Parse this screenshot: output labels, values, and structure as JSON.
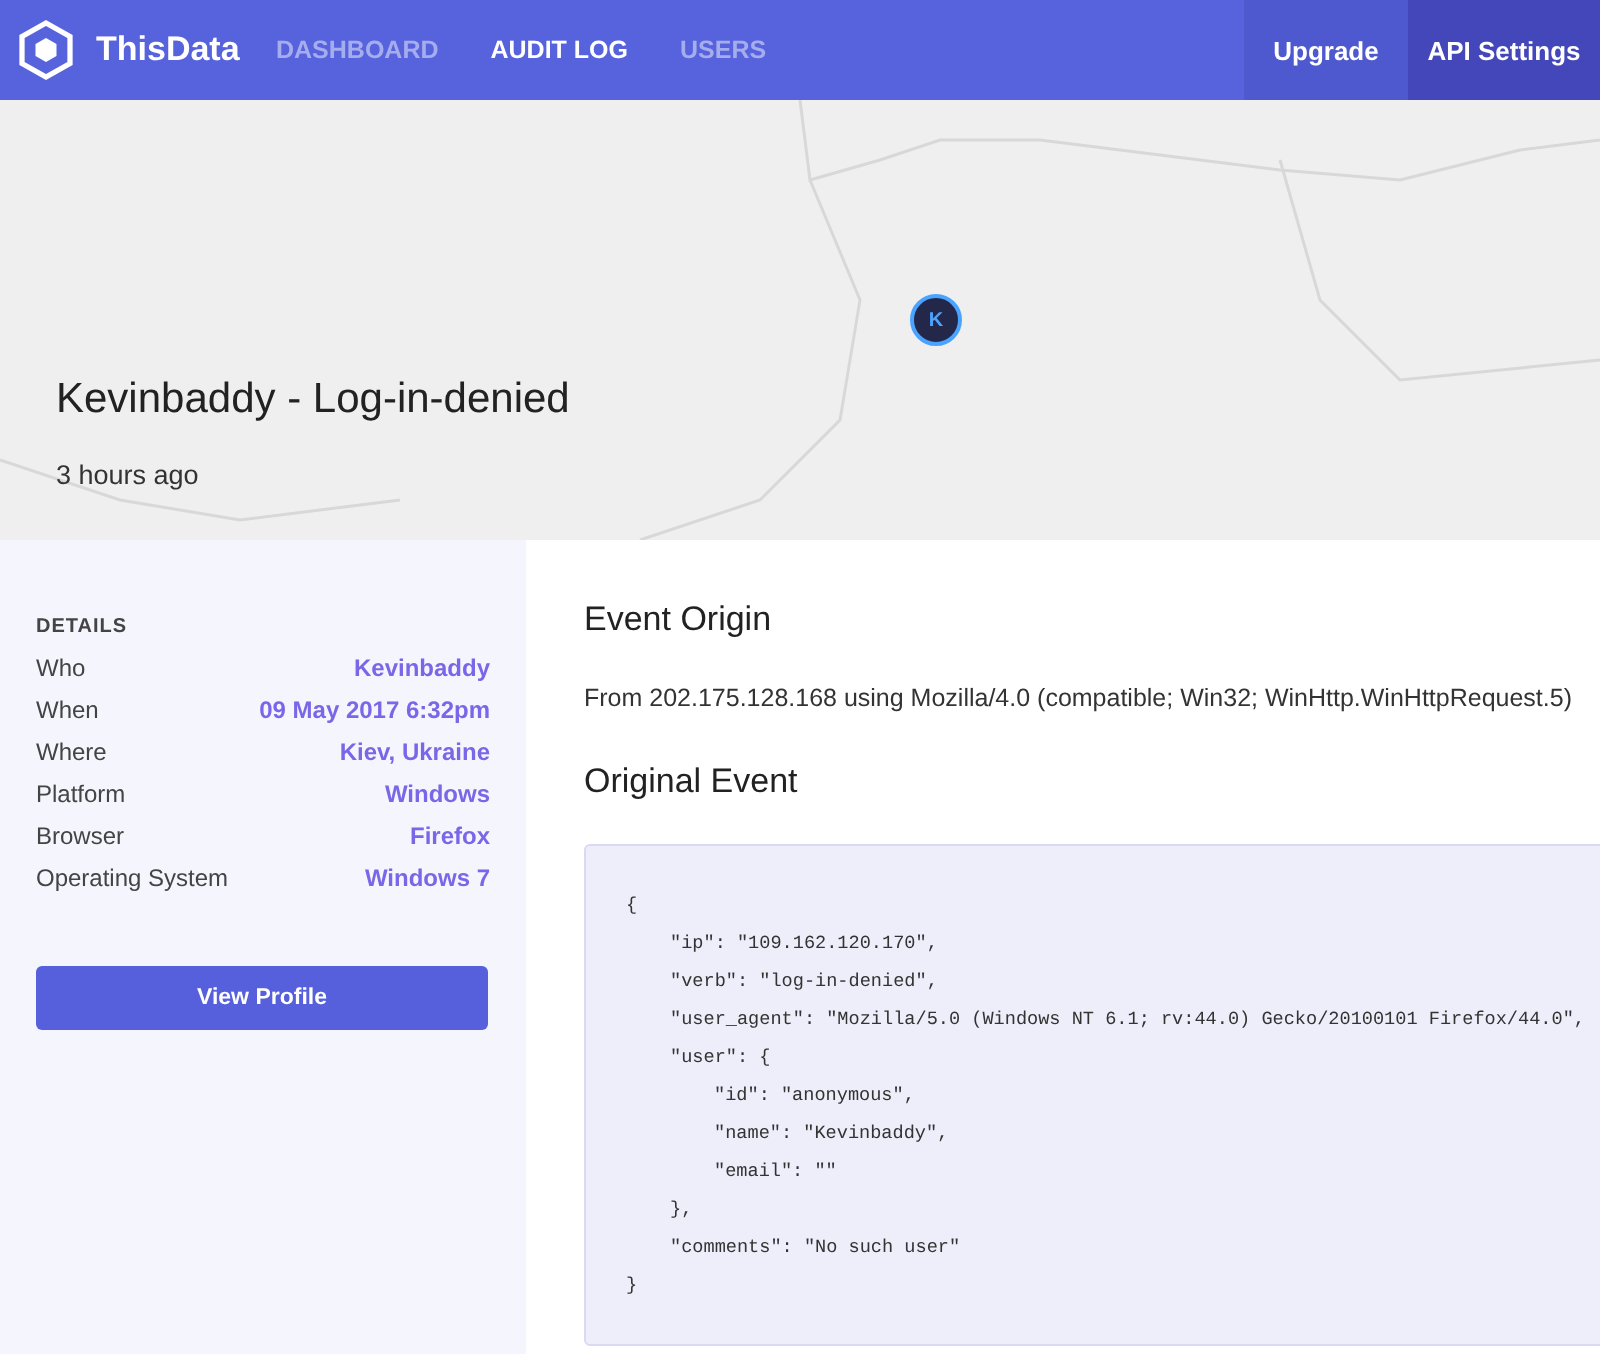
{
  "navbar": {
    "brand": "ThisData",
    "links": [
      {
        "label": "DASHBOARD",
        "selected": false
      },
      {
        "label": "AUDIT LOG",
        "selected": true
      },
      {
        "label": "USERS",
        "selected": false
      }
    ],
    "actions": [
      "Upgrade",
      "API Settings"
    ]
  },
  "hero": {
    "marker": "K",
    "title": "Kevinbaddy - Log-in-denied",
    "time": "3 hours ago"
  },
  "details": {
    "heading": "DETAILS",
    "rows": [
      {
        "label": "Who",
        "value": "Kevinbaddy"
      },
      {
        "label": "When",
        "value": "09 May 2017 6:32pm"
      },
      {
        "label": "Where",
        "value": "Kiev, Ukraine"
      },
      {
        "label": "Platform",
        "value": "Windows"
      },
      {
        "label": "Browser",
        "value": "Firefox"
      },
      {
        "label": "Operating System",
        "value": "Windows 7"
      }
    ],
    "button": "View Profile"
  },
  "event_origin": {
    "heading": "Event Origin",
    "text": "From 202.175.128.168 using Mozilla/4.0 (compatible; Win32; WinHttp.WinHttpRequest.5)"
  },
  "original_event": {
    "heading": "Original Event",
    "lines": [
      {
        "text": "{",
        "children": [
          {
            "text": "\"ip\": \"109.162.120.170\","
          },
          {
            "text": "\"verb\": \"log-in-denied\","
          },
          {
            "text": "\"user_agent\": \"Mozilla/5.0 (Windows NT 6.1; rv:44.0) Gecko/20100101 Firefox/44.0\","
          },
          {
            "text": "\"user\": {",
            "children": [
              {
                "text": "\"id\": \"anonymous\","
              },
              {
                "text": "\"name\": \"Kevinbaddy\","
              },
              {
                "text": "\"email\": \"\""
              }
            ]
          },
          {
            "text": "},"
          },
          {
            "text": "\"comments\": \"No such user\""
          }
        ]
      },
      {
        "text": "}"
      }
    ]
  }
}
